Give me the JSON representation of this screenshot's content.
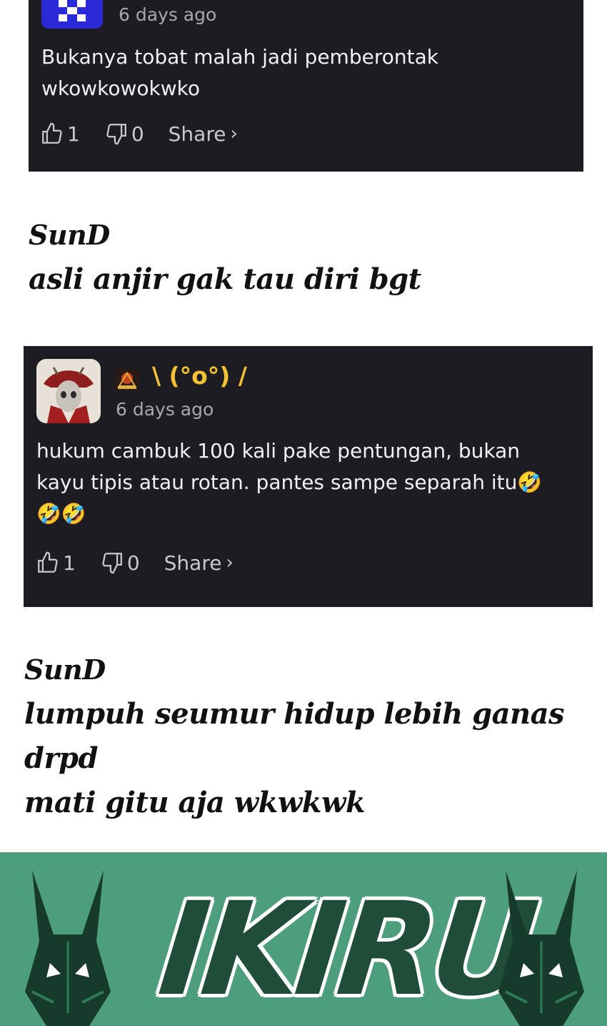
{
  "comments": [
    {
      "time": "6 days ago",
      "text": "Bukanya tobat malah jadi pemberontak\nwkowkowokwko",
      "likes": "1",
      "dislikes": "0",
      "share_label": "Share"
    },
    {
      "username": "\\ (°o°) /",
      "time": "6 days ago",
      "text": "hukum cambuk 100 kali pake pentungan, bukan\nkayu tipis atau rotan. pantes sampe separah itu🤣\n🤣🤣",
      "likes": "1",
      "dislikes": "0",
      "share_label": "Share"
    }
  ],
  "overlays": [
    {
      "name": "SunD",
      "text": "asli anjir gak tau diri bgt"
    },
    {
      "name": "SunD",
      "text": "lumpuh seumur hidup lebih ganas drpd\nmati gitu aja wkwkwk"
    }
  ],
  "banner": {
    "logo_text": "IKIRU"
  },
  "colors": {
    "card_bg": "#1c1c22",
    "username": "#f2c230",
    "banner_bg": "#4d9e7c"
  }
}
